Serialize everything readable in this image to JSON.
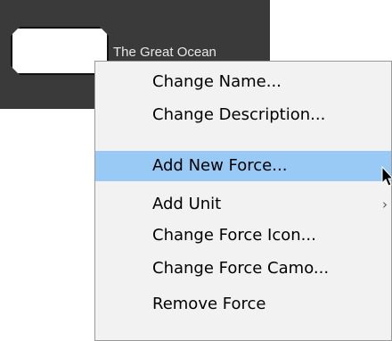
{
  "force": {
    "name": "The Great Ocean"
  },
  "context_menu": {
    "items": [
      {
        "label": "Change Name..."
      },
      {
        "label": "Change Description..."
      },
      {
        "label": "Add New Force...",
        "highlighted": true
      },
      {
        "label": "Add Unit",
        "submenu_arrow": "›"
      },
      {
        "label": "Change Force Icon..."
      },
      {
        "label": "Change Force Camo..."
      },
      {
        "label": "Remove Force"
      }
    ]
  },
  "colors": {
    "panel_background": "#3a3a3a",
    "menu_background": "#f2f2f2",
    "highlight": "#99c9f5",
    "force_name_text": "#e8e8e8"
  },
  "icons": {
    "cursor": "mouse-pointer-icon",
    "submenu": "chevron-right-icon"
  }
}
